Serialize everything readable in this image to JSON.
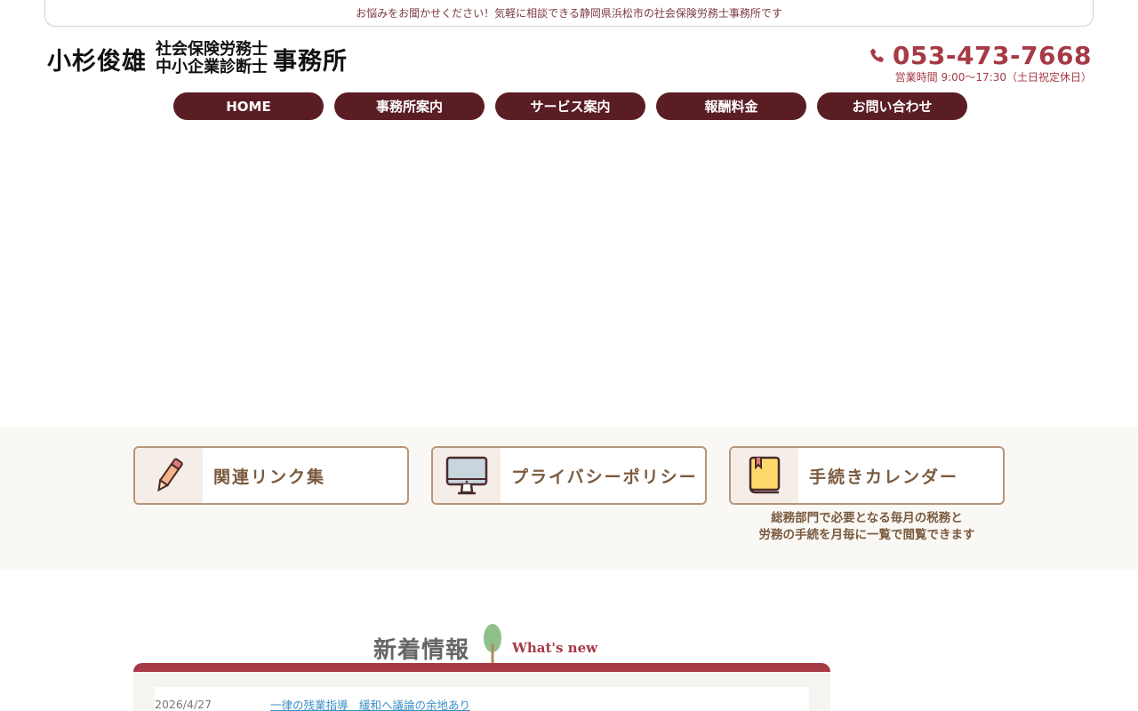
{
  "topbar": {
    "text": "お悩みをお聞かせください！気軽に相談できる静岡県浜松市の社会保険労務士事務所です"
  },
  "logo": {
    "name": "小杉俊雄",
    "title1": "社会保険労務士",
    "title2": "中小企業診断士",
    "office": "事務所"
  },
  "contact": {
    "phone": "053-473-7668",
    "hours": "営業時間 9:00〜17:30（土日祝定休日）"
  },
  "nav": {
    "items": [
      {
        "label": "HOME"
      },
      {
        "label": "事務所案内"
      },
      {
        "label": "サービス案内"
      },
      {
        "label": "報酬料金"
      },
      {
        "label": "お問い合わせ"
      }
    ]
  },
  "links": {
    "items": [
      {
        "label": "関連リンク集",
        "icon": "pen-icon"
      },
      {
        "label": "プライバシーポリシー",
        "icon": "monitor-icon"
      },
      {
        "label": "手続きカレンダー",
        "icon": "book-icon"
      }
    ],
    "calendar_note_1": "総務部門で必要となる毎月の税務と",
    "calendar_note_2": "労務の手続を月毎に一覧で閲覧できます"
  },
  "news": {
    "heading": "新着情報",
    "heading_en": "What's new",
    "items": [
      {
        "date": "2026/4/27",
        "title": "一律の残業指導　緩和へ議論の余地あり"
      }
    ]
  },
  "colors": {
    "accent": "#a63a45",
    "nav_bg": "#5a1d24",
    "card_border": "#b89479",
    "card_text": "#7a5a3e",
    "link": "#3a8fc4"
  }
}
